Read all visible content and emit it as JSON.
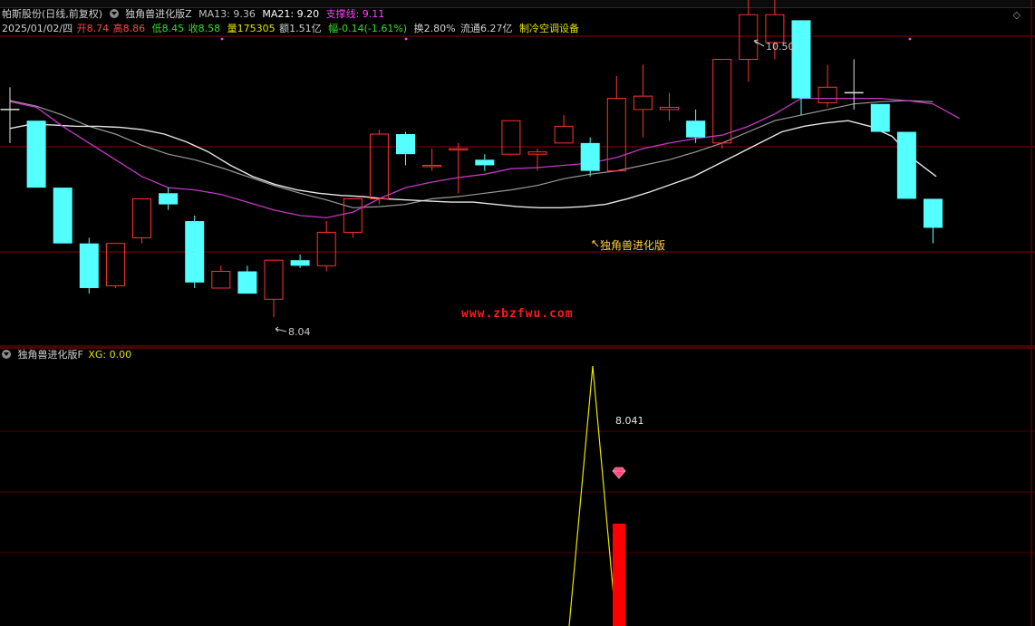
{
  "upper": {
    "stock_name": "帕斯股份(日线,前复权)",
    "indicator": "独角兽进化版Z",
    "ma13": "MA13: 9.36",
    "ma21": "MA21: 9.20",
    "support": "支撑线: 9.11",
    "date": "2025/01/02/四",
    "open": "开8.74",
    "high": "高8.86",
    "low": "低8.45",
    "close": "收8.58",
    "volume": "量175305",
    "amount": "额1.51亿",
    "change": "幅-0.14(-1.61%)",
    "turnover": "换2.80%",
    "float": "流通6.27亿",
    "sector": "制冷空调设备",
    "high_label": "10.50",
    "low_label": "8.04",
    "signal_label": "独角兽进化版",
    "watermark": "www.zbzfwu.com"
  },
  "lower": {
    "indicator": "独角兽进化版F",
    "xg": "XG: 0.00",
    "peak_label": "8.041"
  },
  "colors": {
    "up": "#ff3333",
    "down": "#54ffff",
    "ma13": "#c238c2",
    "ma21": "#999999",
    "support": "#e6e6e6",
    "yellow": "#ffff00",
    "grid": "#8b0000"
  },
  "candles": [
    {
      "o": 9.9,
      "c": 9.9,
      "h": 10.1,
      "l": 9.6
    },
    {
      "o": 9.8,
      "c": 9.2,
      "h": 9.8,
      "l": 9.2
    },
    {
      "o": 9.2,
      "c": 8.7,
      "h": 9.2,
      "l": 8.7
    },
    {
      "o": 8.7,
      "c": 8.3,
      "h": 8.75,
      "l": 8.25
    },
    {
      "o": 8.32,
      "c": 8.7,
      "h": 8.7,
      "l": 8.3
    },
    {
      "o": 8.75,
      "c": 9.1,
      "h": 9.1,
      "l": 8.7
    },
    {
      "o": 9.15,
      "c": 9.05,
      "h": 9.2,
      "l": 9.0
    },
    {
      "o": 8.9,
      "c": 8.35,
      "h": 8.95,
      "l": 8.3
    },
    {
      "o": 8.3,
      "c": 8.45,
      "h": 8.5,
      "l": 8.3
    },
    {
      "o": 8.45,
      "c": 8.25,
      "h": 8.5,
      "l": 8.25
    },
    {
      "o": 8.2,
      "c": 8.55,
      "h": 8.55,
      "l": 8.04
    },
    {
      "o": 8.55,
      "c": 8.5,
      "h": 8.6,
      "l": 8.48
    },
    {
      "o": 8.5,
      "c": 8.8,
      "h": 8.9,
      "l": 8.45
    },
    {
      "o": 8.8,
      "c": 9.1,
      "h": 9.1,
      "l": 8.75
    },
    {
      "o": 9.1,
      "c": 9.68,
      "h": 9.72,
      "l": 9.05
    },
    {
      "o": 9.68,
      "c": 9.5,
      "h": 9.7,
      "l": 9.4
    },
    {
      "o": 9.4,
      "c": 9.4,
      "h": 9.55,
      "l": 9.35
    },
    {
      "o": 9.55,
      "c": 9.55,
      "h": 9.6,
      "l": 9.15
    },
    {
      "o": 9.45,
      "c": 9.4,
      "h": 9.5,
      "l": 9.35
    },
    {
      "o": 9.5,
      "c": 9.8,
      "h": 9.8,
      "l": 9.5
    },
    {
      "o": 9.5,
      "c": 9.52,
      "h": 9.55,
      "l": 9.35
    },
    {
      "o": 9.6,
      "c": 9.75,
      "h": 9.85,
      "l": 9.6
    },
    {
      "o": 9.6,
      "c": 9.35,
      "h": 9.65,
      "l": 9.3
    },
    {
      "o": 9.35,
      "c": 10.0,
      "h": 10.2,
      "l": 9.35
    },
    {
      "o": 9.9,
      "c": 10.02,
      "h": 10.3,
      "l": 9.65
    },
    {
      "o": 9.9,
      "c": 9.92,
      "h": 10.05,
      "l": 9.8
    },
    {
      "o": 9.8,
      "c": 9.65,
      "h": 9.9,
      "l": 9.6
    },
    {
      "o": 9.6,
      "c": 10.35,
      "h": 10.35,
      "l": 9.55
    },
    {
      "o": 10.35,
      "c": 10.75,
      "h": 11.35,
      "l": 10.15
    },
    {
      "o": 10.5,
      "c": 10.75,
      "h": 11.0,
      "l": 10.35
    },
    {
      "o": 10.7,
      "c": 10.0,
      "h": 10.7,
      "l": 9.85
    },
    {
      "o": 9.96,
      "c": 10.1,
      "h": 10.3,
      "l": 9.92
    },
    {
      "o": 10.05,
      "c": 10.04,
      "h": 10.35,
      "l": 9.9
    },
    {
      "o": 9.95,
      "c": 9.7,
      "h": 9.95,
      "l": 9.7
    },
    {
      "o": 9.7,
      "c": 9.1,
      "h": 9.7,
      "l": 9.1
    },
    {
      "o": 9.1,
      "c": 8.84,
      "h": 9.1,
      "l": 8.7
    }
  ],
  "ma13_values": [
    9.97,
    9.92,
    9.75,
    9.6,
    9.45,
    9.3,
    9.2,
    9.18,
    9.14,
    9.07,
    9.0,
    8.95,
    8.93,
    8.98,
    9.1,
    9.2,
    9.25,
    9.29,
    9.32,
    9.37,
    9.38,
    9.4,
    9.42,
    9.47,
    9.55,
    9.6,
    9.64,
    9.67,
    9.75,
    9.86,
    10.0,
    10.0,
    10.0,
    10.0,
    9.98,
    9.95,
    9.82
  ],
  "ma21_values": [
    9.98,
    9.93,
    9.85,
    9.75,
    9.68,
    9.58,
    9.5,
    9.45,
    9.38,
    9.3,
    9.22,
    9.15,
    9.09,
    9.02,
    9.03,
    9.05,
    9.1,
    9.12,
    9.15,
    9.18,
    9.22,
    9.28,
    9.32,
    9.35,
    9.4,
    9.45,
    9.52,
    9.6,
    9.7,
    9.8,
    9.85,
    9.9,
    9.95,
    9.97,
    9.98,
    9.97
  ],
  "support_values": [
    9.73,
    9.77,
    9.76,
    9.75,
    9.75,
    9.74,
    9.72,
    9.68,
    9.61,
    9.52,
    9.4,
    9.3,
    9.23,
    9.18,
    9.15,
    9.13,
    9.12,
    9.1,
    9.09,
    9.08,
    9.07,
    9.07,
    9.05,
    9.03,
    9.02,
    9.02,
    9.03,
    9.05,
    9.1,
    9.16,
    9.23,
    9.3,
    9.4,
    9.5,
    9.6,
    9.7,
    9.75,
    9.78,
    9.8,
    9.75,
    9.66,
    9.45,
    9.3
  ]
}
